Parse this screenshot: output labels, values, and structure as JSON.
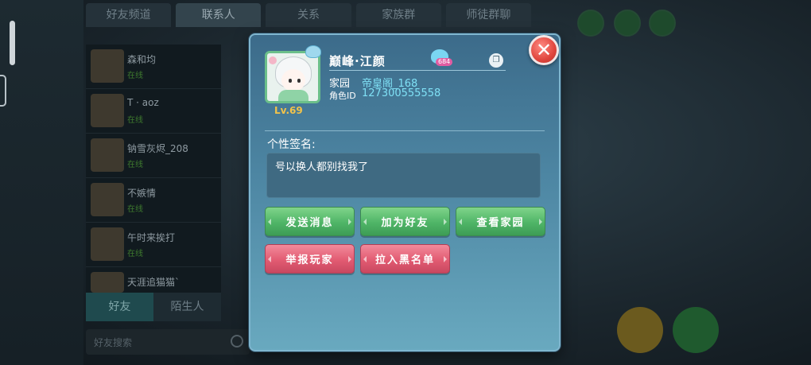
{
  "background": {
    "tabs": [
      "好友频道",
      "联系人",
      "关系",
      "家族群",
      "师徒群聊"
    ],
    "active_tab": 1,
    "contacts": [
      {
        "name": "森和均",
        "status": "在线"
      },
      {
        "name": "T · aoz",
        "status": "在线"
      },
      {
        "name": "钠雪灰烬_208",
        "status": "在线"
      },
      {
        "name": "不嫉情",
        "status": "在线"
      },
      {
        "name": "午时来挨打",
        "status": "在线"
      },
      {
        "name": "天涯追猫猫`",
        "status": ""
      }
    ],
    "bottom_tabs": [
      "好友",
      "陌生人"
    ],
    "search_placeholder": "好友搜索"
  },
  "profile": {
    "name": "巅峰·江颜",
    "level": "Lv.69",
    "heart_count": "684",
    "home_label": "家园",
    "home_value": "帝皇阁_168",
    "id_label": "角色ID",
    "id_value": "127300555558",
    "signature_title": "个性签名:",
    "signature": "号以换人都别找我了"
  },
  "actions": {
    "send_message": "发送消息",
    "add_friend": "加为好友",
    "view_home": "查看家园",
    "report_player": "举报玩家",
    "blacklist": "拉入黑名单"
  },
  "colors": {
    "green_button": "#4fb567",
    "red_button": "#e25b72",
    "accent_value": "#7fe0f5",
    "level": "#f2c34a"
  },
  "icons": {
    "close": "close-icon",
    "copy": "copy-icon",
    "heart_badge": "heart-icon",
    "search": "search-icon"
  }
}
